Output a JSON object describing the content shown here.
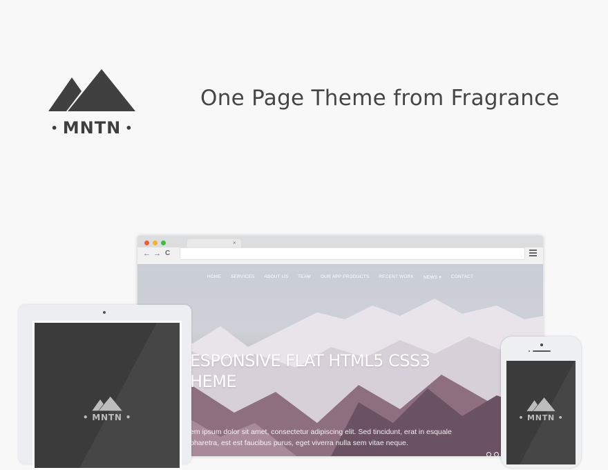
{
  "brand": {
    "logo_text": "MNTN",
    "logo_bullet": "•",
    "tagline": "One Page Theme from Fragrance",
    "logo_color": "#3e3e3e"
  },
  "browser": {
    "tab_close": "×",
    "back_glyph": "←",
    "forward_glyph": "→",
    "reload_glyph": "C",
    "traffic_lights": [
      "#f05a3e",
      "#f5b324",
      "#3cbf3c"
    ],
    "site_nav": [
      "HOME",
      "SERVICES",
      "ABOUT US",
      "TEAM",
      "OUR APP PRODUCTS",
      "RECENT WORK",
      "NEWS ▾",
      "CONTACT"
    ],
    "hero_title": "ESPONSIVE FLAT HTML5 CSS3 HEME",
    "hero_text": "em ipsum dolor sit amet, consectetur adipiscing elit. Sed tincidunt, erat in esquale pharetra, est est faucibus purus, eget viverra nulla sem vitae neque."
  },
  "tablet": {
    "logo_text": "MNTN",
    "logo_bullet": "•"
  },
  "phone": {
    "logo_text": "MNTN",
    "logo_bullet": "•"
  }
}
